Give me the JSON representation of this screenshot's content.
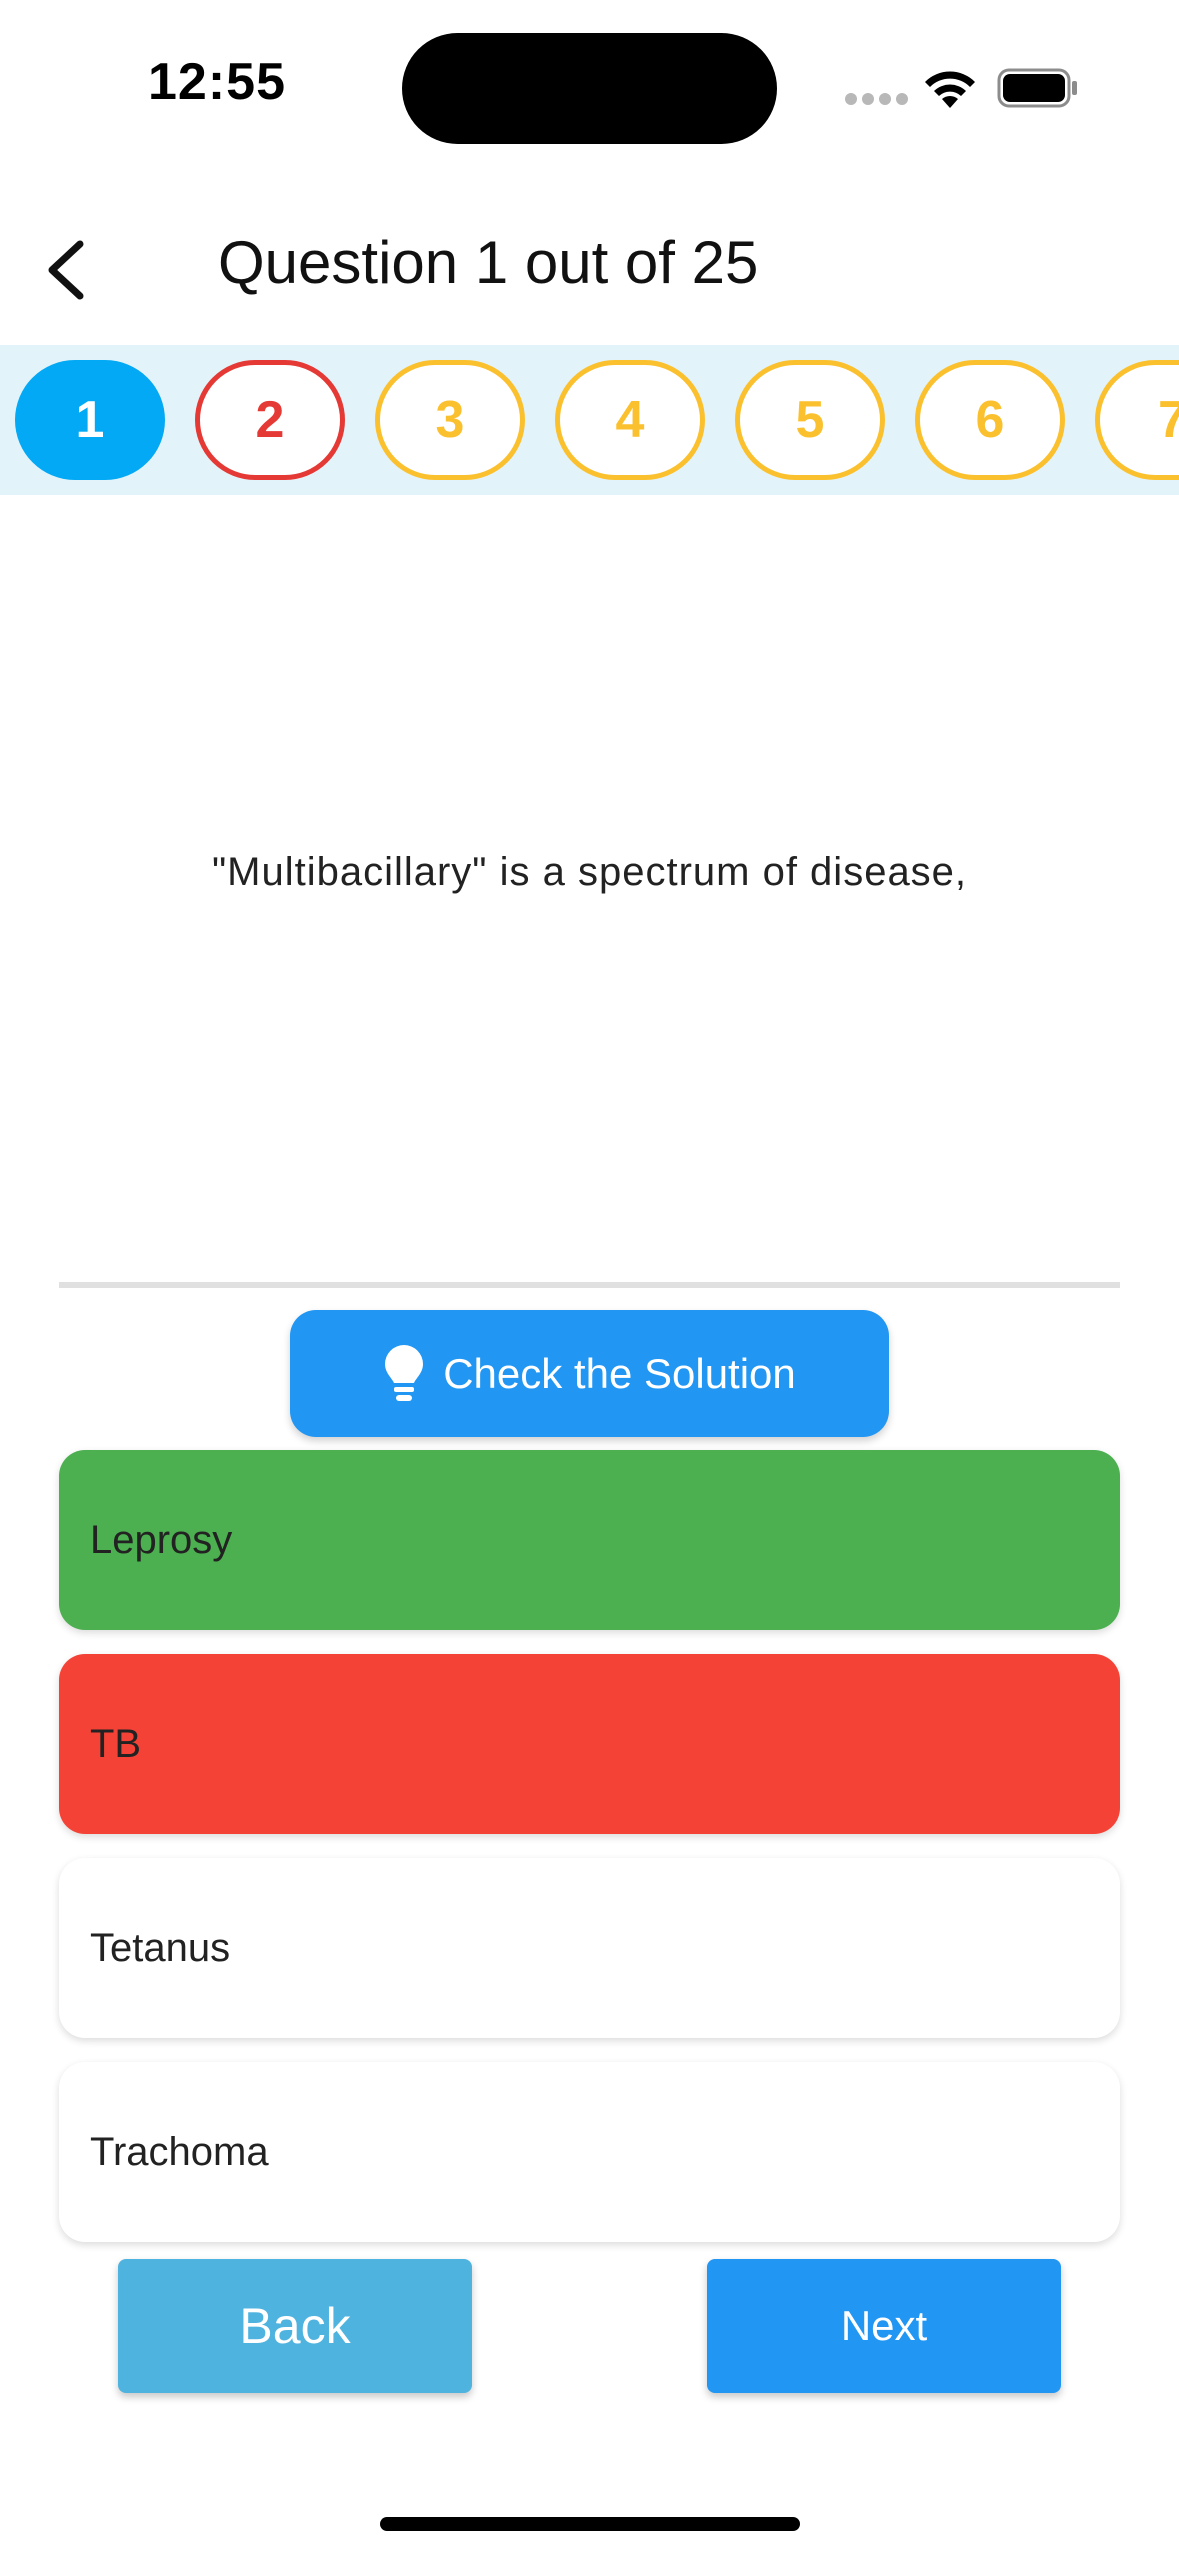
{
  "status_bar": {
    "time": "12:55"
  },
  "header": {
    "title": "Question 1 out of 25"
  },
  "question_strip": [
    {
      "label": "1",
      "state": "current"
    },
    {
      "label": "2",
      "state": "wrong"
    },
    {
      "label": "3",
      "state": "pending"
    },
    {
      "label": "4",
      "state": "pending"
    },
    {
      "label": "5",
      "state": "pending"
    },
    {
      "label": "6",
      "state": "pending"
    },
    {
      "label": "7",
      "state": "pending"
    }
  ],
  "question": {
    "text": "\"Multibacillary\" is a spectrum of disease,"
  },
  "check_solution": {
    "label": "Check the Solution",
    "icon": "lightbulb-icon"
  },
  "options": [
    {
      "label": "Leprosy",
      "state": "correct"
    },
    {
      "label": "TB",
      "state": "incorrect"
    },
    {
      "label": "Tetanus",
      "state": "neutral"
    },
    {
      "label": "Trachoma",
      "state": "neutral"
    }
  ],
  "navigation": {
    "back_label": "Back",
    "next_label": "Next"
  },
  "colors": {
    "accent": "#2196f3",
    "current_question": "#03a9f4",
    "wrong": "#e53935",
    "pending": "#fbc02d",
    "correct_option": "#4caf50",
    "incorrect_option": "#f44336",
    "strip_background": "#e3f3fa"
  }
}
